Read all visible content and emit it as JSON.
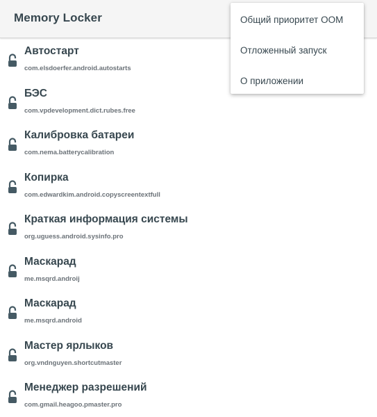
{
  "toolbar": {
    "title": "Memory Locker"
  },
  "menu": {
    "items": [
      {
        "label": "Общий приоритет ООМ"
      },
      {
        "label": "Отложенный запуск"
      },
      {
        "label": "О приложении"
      }
    ]
  },
  "apps": [
    {
      "name": "Автостарт",
      "package": "com.elsdoerfer.android.autostarts",
      "icon": "lock-open-icon"
    },
    {
      "name": "БЭС",
      "package": "com.vpdevelopment.dict.rubes.free",
      "icon": "lock-open-icon"
    },
    {
      "name": "Калибровка батареи",
      "package": "com.nema.batterycalibration",
      "icon": "lock-open-icon"
    },
    {
      "name": "Копирка",
      "package": "com.edwardkim.android.copyscreentextfull",
      "icon": "lock-open-icon"
    },
    {
      "name": "Краткая информация системы",
      "package": "org.uguess.android.sysinfo.pro",
      "icon": "lock-open-icon"
    },
    {
      "name": "Маскарад",
      "package": "me.msqrd.androij",
      "icon": "lock-open-icon"
    },
    {
      "name": "Маскарад",
      "package": "me.msqrd.android",
      "icon": "lock-open-icon"
    },
    {
      "name": "Мастер ярлыков",
      "package": "org.vndnguyen.shortcutmaster",
      "icon": "lock-open-icon"
    },
    {
      "name": "Менеджер разрешений",
      "package": "com.gmail.heagoo.pmaster.pro",
      "icon": "lock-open-icon"
    }
  ],
  "colors": {
    "text": "#37474f",
    "secondary_text": "#6b7278",
    "toolbar_bg": "#f5f5f5",
    "icon": "#455a64"
  }
}
